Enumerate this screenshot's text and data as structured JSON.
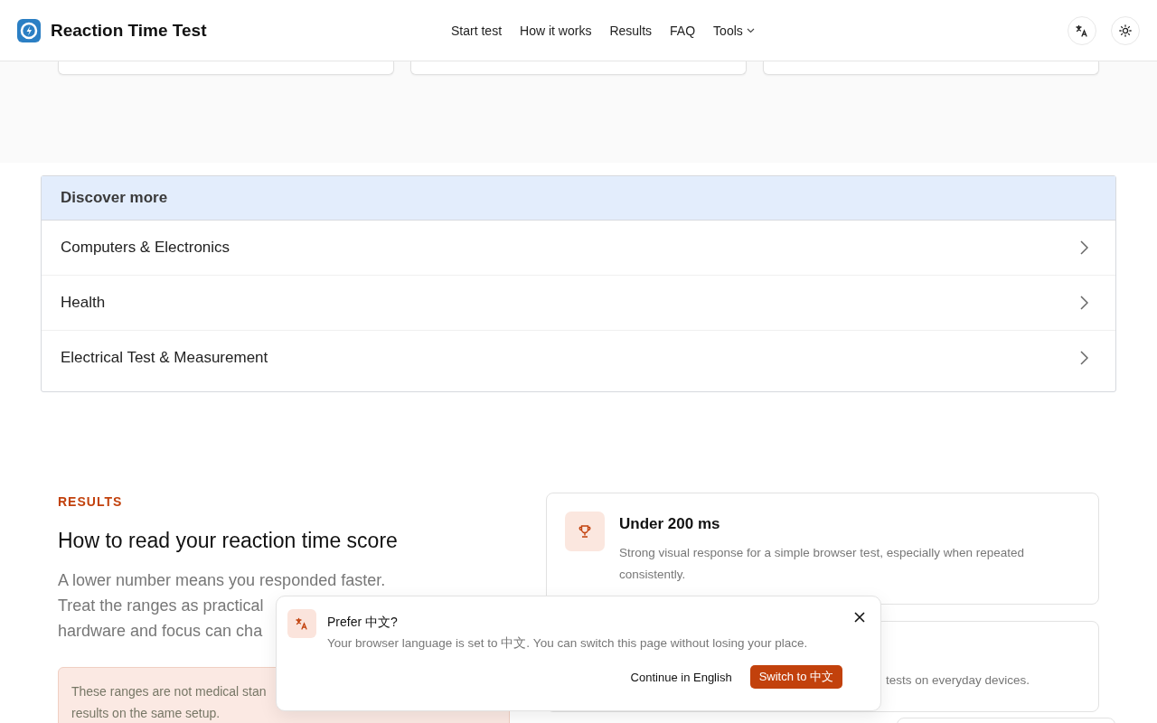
{
  "header": {
    "title": "Reaction Time Test",
    "nav": [
      {
        "label": "Start test",
        "kind": "link"
      },
      {
        "label": "How it works",
        "kind": "link"
      },
      {
        "label": "Results",
        "kind": "link"
      },
      {
        "label": "FAQ",
        "kind": "link"
      },
      {
        "label": "Tools",
        "kind": "menu"
      }
    ]
  },
  "discover": {
    "title": "Discover more",
    "items": [
      "Computers & Electronics",
      "Health",
      "Electrical Test & Measurement"
    ]
  },
  "results": {
    "eyebrow": "RESULTS",
    "heading": "How to read your reaction time score",
    "paragraph_lines": [
      "A lower number means you responded faster.",
      "Treat the ranges as practical",
      "hardware and focus can cha"
    ],
    "note_lines": [
      "These ranges are not medical stan",
      "results on the same setup."
    ],
    "cards": [
      {
        "title": "Under 200 ms",
        "text": "Strong visual response for a simple browser test, especially when repeated consistently."
      },
      {
        "text": "tests on everyday devices."
      }
    ]
  },
  "toast": {
    "title": "Prefer 中文?",
    "text": "Your browser language is set to 中文. You can switch this page without losing your place.",
    "secondary": "Continue in English",
    "primary": "Switch to 中文"
  }
}
